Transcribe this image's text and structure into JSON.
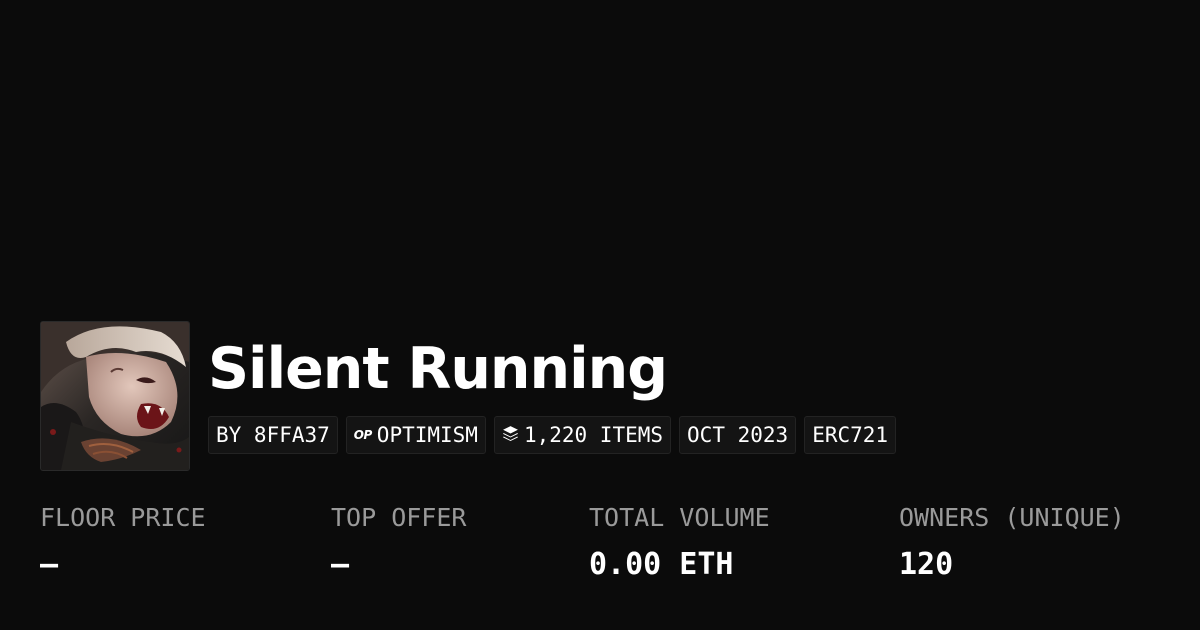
{
  "collection": {
    "name": "Silent Running",
    "avatar_icon": "collection-artwork-illustrated-vampire"
  },
  "tags": {
    "creator": "BY 8FFA37",
    "chain_logo": "OP",
    "chain": "OPTIMISM",
    "items_icon": "layers-icon",
    "items": "1,220 ITEMS",
    "date": "OCT 2023",
    "standard": "ERC721"
  },
  "stats": {
    "floor_price": {
      "label": "FLOOR PRICE",
      "value": "–"
    },
    "top_offer": {
      "label": "TOP OFFER",
      "value": "–"
    },
    "total_volume": {
      "label": "TOTAL VOLUME",
      "value": "0.00 ETH"
    },
    "owners": {
      "label": "OWNERS (UNIQUE)",
      "value": "120"
    }
  },
  "colors": {
    "background": "#0b0b0b",
    "text_primary": "#ffffff",
    "text_secondary": "#9a9a9a",
    "tag_background": "#141414",
    "tag_border": "#232323"
  }
}
